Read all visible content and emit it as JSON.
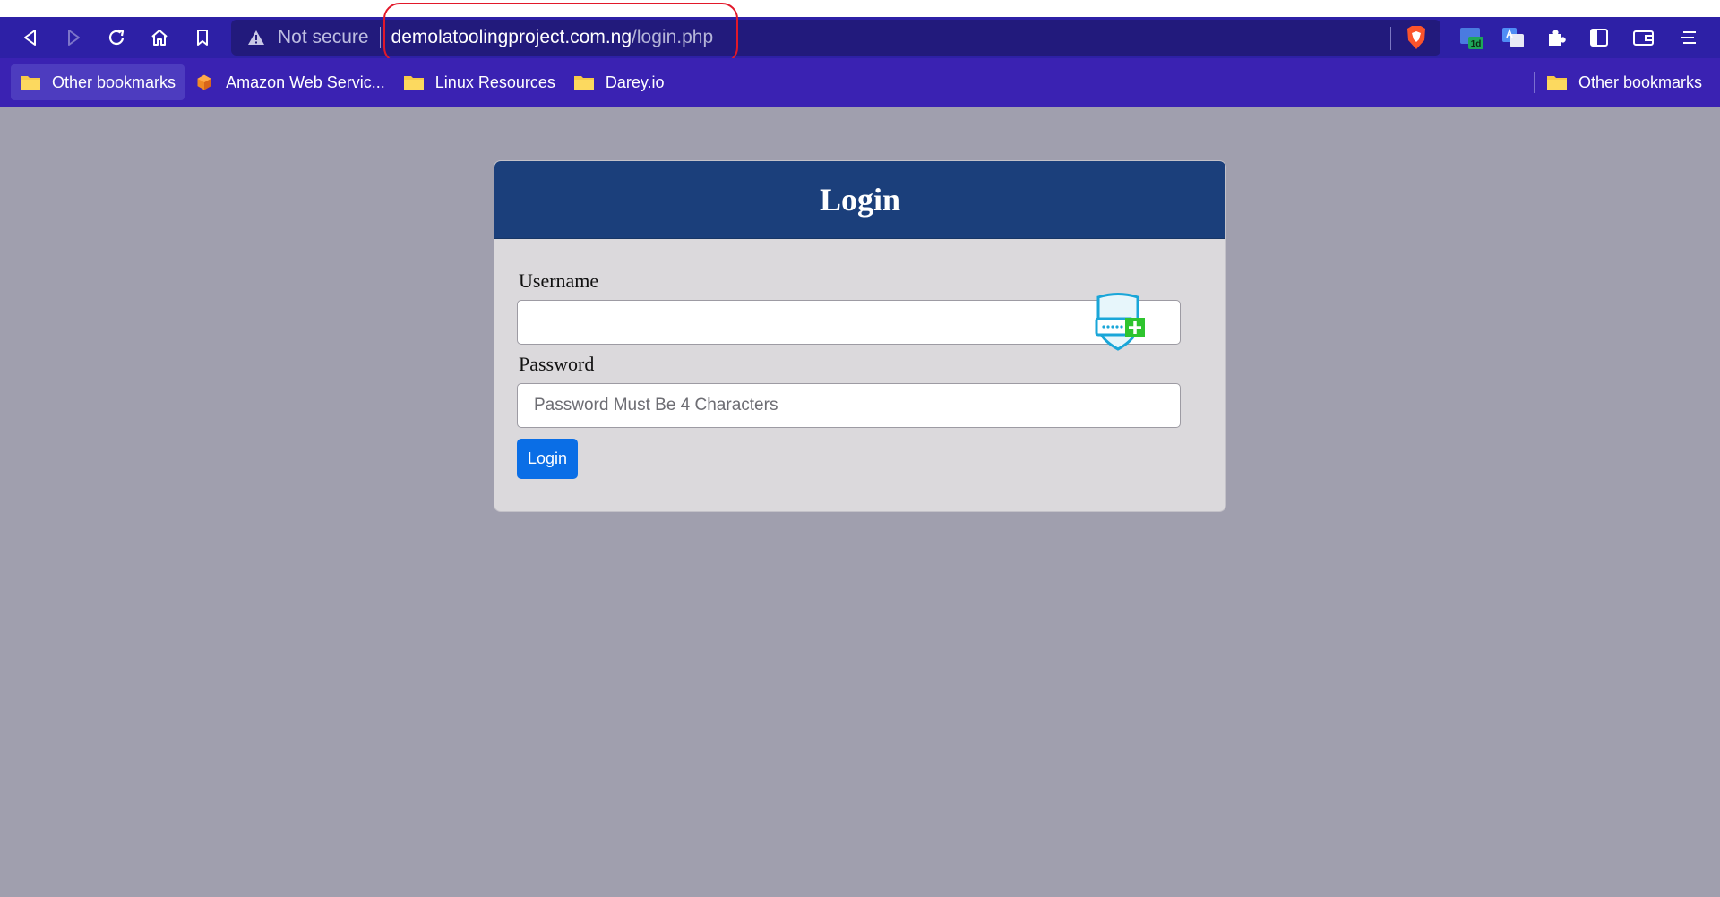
{
  "browser": {
    "nav": {
      "back_icon": "back-triangle-icon",
      "forward_icon": "forward-triangle-icon",
      "reload_icon": "reload-icon",
      "home_icon": "home-icon",
      "bookmark_icon": "bookmark-icon"
    },
    "address_bar": {
      "security_label": "Not secure",
      "url_host": "demolatoolingproject.com.ng",
      "url_path": "/login.php",
      "annotation_color": "#e2182a"
    },
    "extensions": [
      "brave-shields-icon",
      "calendar-1d-icon",
      "translate-icon",
      "extensions-puzzle-icon",
      "sidebar-icon",
      "wallet-icon",
      "menu-icon"
    ],
    "calendar_badge": "1d",
    "bookmarks": [
      {
        "label": "Other bookmarks",
        "icon": "folder-icon"
      },
      {
        "label": "Amazon Web Servic...",
        "icon": "aws-cube-icon"
      },
      {
        "label": "Linux Resources",
        "icon": "folder-icon"
      },
      {
        "label": "Darey.io",
        "icon": "folder-icon"
      }
    ],
    "bookmarks_right": {
      "label": "Other bookmarks",
      "icon": "folder-icon"
    },
    "colors": {
      "toolbar": "#2d20a6",
      "bookmarks_bar": "#3a22b2"
    }
  },
  "login": {
    "title": "Login",
    "username_label": "Username",
    "username_value": "",
    "password_label": "Password",
    "password_placeholder": "Password Must Be 4 Characters",
    "submit_label": "Login",
    "colors": {
      "header": "#1b3f7b",
      "button": "#0a6ee6",
      "page_bg": "#a09fae"
    }
  }
}
